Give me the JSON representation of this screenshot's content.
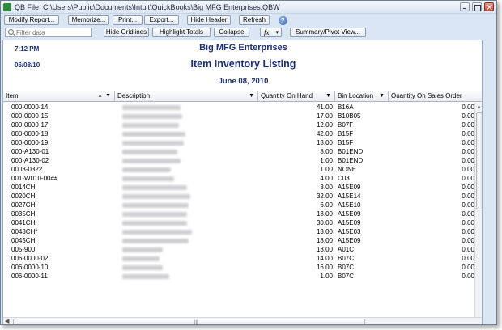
{
  "window": {
    "title": "QB File: C:\\Users\\Public\\Documents\\Intuit\\QuickBooks\\Big MFG Enterprises.QBW"
  },
  "toolbar": {
    "modify_report": "Modify Report...",
    "memorize": "Memorize...",
    "print": "Print...",
    "export": "Export...",
    "hide_header": "Hide Header",
    "refresh": "Refresh",
    "help_icon": "?"
  },
  "toolbar2": {
    "filter_placeholder": "Filter data",
    "hide_gridlines": "Hide Gridlines",
    "highlight_totals": "Highlight Totals",
    "collapse": "Collapse",
    "fx": "fx",
    "summary_pivot": "Summary/Pivot View..."
  },
  "report": {
    "time": "7:12 PM",
    "date": "06/08/10",
    "company": "Big MFG Enterprises",
    "title": "Item Inventory Listing",
    "range": "June 08, 2010"
  },
  "columns": [
    "Item",
    "Description",
    "Quantity On Hand",
    "Bin Location",
    "Quantity On Sales Order"
  ],
  "rows": [
    {
      "item": "000-0000-14",
      "qty": "41.00",
      "bin": "B16A",
      "so": "0.00"
    },
    {
      "item": "000-0000-15",
      "qty": "17.00",
      "bin": "B10B05",
      "so": "0.00"
    },
    {
      "item": "000-0000-17",
      "qty": "12.00",
      "bin": "B07F",
      "so": "0.00"
    },
    {
      "item": "000-0000-18",
      "qty": "42.00",
      "bin": "B15F",
      "so": "0.00"
    },
    {
      "item": "000-0000-19",
      "qty": "13.00",
      "bin": "B15F",
      "so": "0.00"
    },
    {
      "item": "000-A130-01",
      "qty": "8.00",
      "bin": "B01END",
      "so": "0.00"
    },
    {
      "item": "000-A130-02",
      "qty": "1.00",
      "bin": "B01END",
      "so": "0.00"
    },
    {
      "item": "0003-0322",
      "qty": "1.00",
      "bin": "NONE",
      "so": "0.00"
    },
    {
      "item": "001-W010-00##",
      "qty": "4.00",
      "bin": "C03",
      "so": "0.00"
    },
    {
      "item": "0014CH",
      "qty": "3.00",
      "bin": "A15E09",
      "so": "0.00"
    },
    {
      "item": "0020CH",
      "qty": "32.00",
      "bin": "A15E14",
      "so": "0.00"
    },
    {
      "item": "0027CH",
      "qty": "6.00",
      "bin": "A15E10",
      "so": "0.00"
    },
    {
      "item": "0035CH",
      "qty": "13.00",
      "bin": "A15E09",
      "so": "0.00"
    },
    {
      "item": "0041CH",
      "qty": "30.00",
      "bin": "A15E09",
      "so": "0.00"
    },
    {
      "item": "0043CH*",
      "qty": "13.00",
      "bin": "A15E03",
      "so": "0.00"
    },
    {
      "item": "0045CH",
      "qty": "18.00",
      "bin": "A15E09",
      "so": "0.00"
    },
    {
      "item": "005-900",
      "qty": "13.00",
      "bin": "A01C",
      "so": "0.00"
    },
    {
      "item": "006-0000-02",
      "qty": "14.00",
      "bin": "B07C",
      "so": "0.00"
    },
    {
      "item": "006-0000-10",
      "qty": "16.00",
      "bin": "B07C",
      "so": "0.00"
    },
    {
      "item": "006-0000-11",
      "qty": "1.00",
      "bin": "B07C",
      "so": "0.00"
    }
  ]
}
